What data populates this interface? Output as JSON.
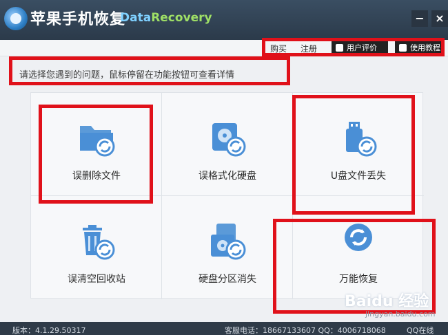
{
  "app": {
    "title_cn": "苹果手机恢复",
    "title_en_part1": "Data",
    "title_en_part2": "Recovery",
    "minimize": "−",
    "close": "×"
  },
  "header_links": {
    "buy": "购买",
    "register": "注册",
    "review": "用户评价",
    "guide": "使用教程"
  },
  "prompt": "请选择您遇到的问题，鼠标停留在功能按钮可查看详情",
  "tiles": [
    {
      "label": "误删除文件",
      "icon": "folder-restore-icon"
    },
    {
      "label": "误格式化硬盘",
      "icon": "harddisk-restore-icon"
    },
    {
      "label": "U盘文件丢失",
      "icon": "usb-restore-icon"
    },
    {
      "label": "误清空回收站",
      "icon": "recycle-bin-restore-icon"
    },
    {
      "label": "硬盘分区消失",
      "icon": "partition-restore-icon"
    },
    {
      "label": "万能恢复",
      "icon": "universal-restore-icon"
    }
  ],
  "status": {
    "version": "版本：4.1.29.50317",
    "service": "客服电话：18667133607 QQ：4006718068",
    "online": "QQ在线"
  },
  "watermark": {
    "brand": "Baidu 经验",
    "site": "jingyan.baidu.com"
  },
  "colors": {
    "accent": "#4a8fd6",
    "highlight": "#e0111a"
  }
}
